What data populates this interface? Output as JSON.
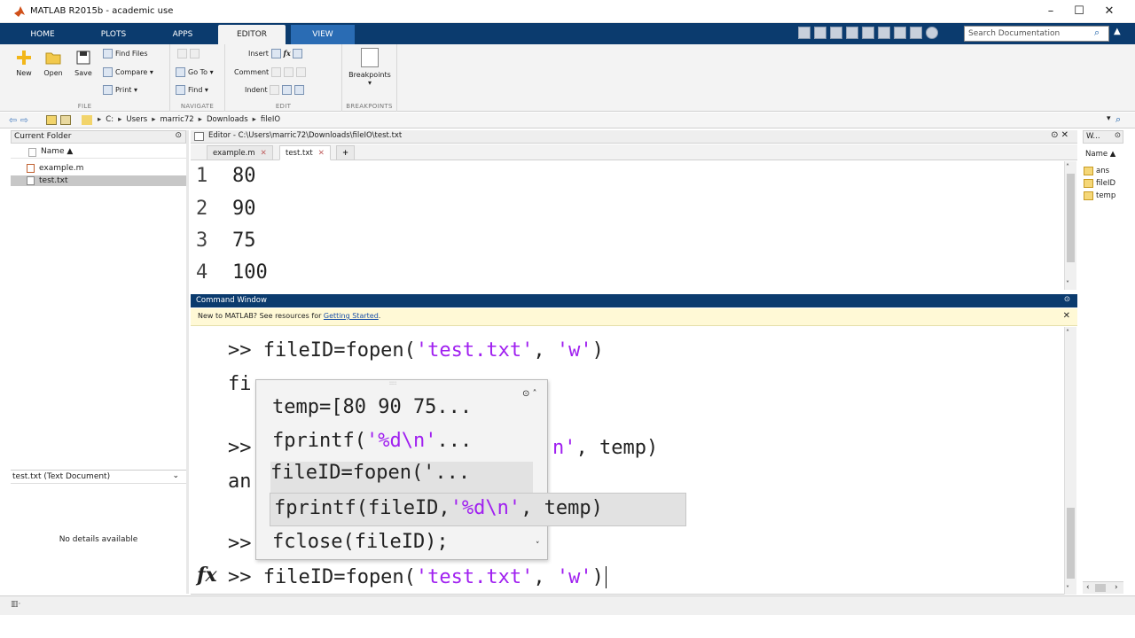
{
  "window": {
    "title": "MATLAB R2015b - academic use",
    "minimize": "–",
    "maximize": "☐",
    "close": "✕"
  },
  "ribbon": {
    "tabs": [
      "HOME",
      "PLOTS",
      "APPS",
      "EDITOR",
      "VIEW"
    ],
    "active_tab": "EDITOR",
    "search_placeholder": "Search Documentation"
  },
  "toolstrip": {
    "file": {
      "label": "FILE",
      "new": "New",
      "open": "Open",
      "save": "Save",
      "find_files": "Find Files",
      "compare": "Compare ▾",
      "print": "Print ▾"
    },
    "navigate": {
      "label": "NAVIGATE",
      "go_to": "Go To ▾",
      "find": "Find ▾"
    },
    "edit": {
      "label": "EDIT",
      "insert": "Insert",
      "comment": "Comment",
      "indent": "Indent"
    },
    "breakpoints": {
      "label": "BREAKPOINTS",
      "breakpoints": "Breakpoints"
    }
  },
  "address": {
    "parts": [
      "C:",
      "Users",
      "marric72",
      "Downloads",
      "fileIO"
    ]
  },
  "current_folder": {
    "title": "Current Folder",
    "column": "Name ▲",
    "files": [
      "example.m",
      "test.txt"
    ],
    "selected": "test.txt",
    "details_title": "test.txt  (Text Document)",
    "details_text": "No details available"
  },
  "editor": {
    "title": "Editor - C:\\Users\\marric72\\Downloads\\fileIO\\test.txt",
    "tabs": [
      "example.m",
      "test.txt"
    ],
    "add_tab": "+",
    "lines": [
      {
        "num": "1",
        "text": "80"
      },
      {
        "num": "2",
        "text": "90"
      },
      {
        "num": "3",
        "text": "75"
      },
      {
        "num": "4",
        "text": "100"
      }
    ]
  },
  "command_window": {
    "title": "Command Window",
    "notice_prefix": "New to MATLAB? See resources for ",
    "notice_link": "Getting Started",
    "notice_suffix": ".",
    "line1_prefix": ">> fileID=fopen(",
    "line1_s1": "'test.txt'",
    "line1_mid": ", ",
    "line1_s2": "'w'",
    "line1_end": ")",
    "line2": "fi",
    "line3_prefix": ">>",
    "line3_tail_str": "n'",
    "line3_tail": ", temp)",
    "line4": "an",
    "line5": ">>",
    "prompt_prefix": ">> fileID=fopen(",
    "prompt_s1": "'test.txt'",
    "prompt_mid": ", ",
    "prompt_s2": "'w'",
    "prompt_end": ")"
  },
  "history_popup": {
    "item1": "temp=[80 90 75...",
    "item2_a": "fprintf(",
    "item2_s": "'%d\\n'",
    "item2_b": "...",
    "item3": "fileID=fopen('...",
    "item4_a": "fprintf(fileID,",
    "item4_s": "'%d\\n'",
    "item4_b": ", temp)",
    "item5": "fclose(fileID);"
  },
  "workspace": {
    "title": "W...",
    "column": "Name ▲",
    "vars": [
      "ans",
      "fileID",
      "temp"
    ]
  },
  "colors": {
    "ribbon": "#0b3b6e",
    "string": "#a020f0",
    "notice": "#fff9d6"
  }
}
